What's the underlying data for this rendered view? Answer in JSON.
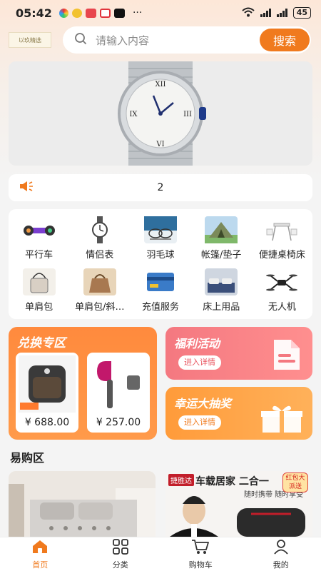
{
  "status_bar": {
    "time": "05:42",
    "more": "···",
    "battery": "45",
    "signal": "6"
  },
  "header": {
    "logo_text": "以玖精选",
    "search_placeholder": "请输入内容",
    "search_button": "搜索"
  },
  "banner": {
    "image": "watch-banner"
  },
  "notice": {
    "icon": "speaker-icon",
    "text": "2"
  },
  "categories": [
    {
      "label": "平行车",
      "icon": "hoverboard-icon"
    },
    {
      "label": "情侣表",
      "icon": "watch-icon"
    },
    {
      "label": "羽毛球",
      "icon": "badminton-icon"
    },
    {
      "label": "帐篷/垫子",
      "icon": "tent-icon"
    },
    {
      "label": "便捷桌椅床",
      "icon": "table-chair-icon"
    },
    {
      "label": "单肩包",
      "icon": "bag-icon"
    },
    {
      "label": "单肩包/斜…",
      "icon": "handbag-icon"
    },
    {
      "label": "充值服务",
      "icon": "card-icon"
    },
    {
      "label": "床上用品",
      "icon": "bed-icon"
    },
    {
      "label": "无人机",
      "icon": "drone-icon"
    }
  ],
  "exchange": {
    "title": "兑换专区",
    "products": [
      {
        "price": "¥ 688.00",
        "image": "air-fryer"
      },
      {
        "price": "¥ 257.00",
        "image": "hair-dryer"
      }
    ]
  },
  "welfare": {
    "title": "福利活动",
    "button": "进入详情",
    "icon": "document-icon"
  },
  "lucky": {
    "title": "幸运大抽奖",
    "button": "进入详情",
    "icon": "gift-icon"
  },
  "section": {
    "title": "易购区"
  },
  "goods": [
    {
      "image": "bedding"
    },
    {
      "brand": "捷胜达",
      "title": "车载居家 二合一",
      "sub": "随时携带 随时享受",
      "tag": "红包大派送",
      "image": "car-massager"
    }
  ],
  "tabbar": [
    {
      "label": "首页",
      "icon": "home-icon",
      "active": true
    },
    {
      "label": "分类",
      "icon": "grid-icon",
      "active": false
    },
    {
      "label": "购物车",
      "icon": "cart-icon",
      "active": false
    },
    {
      "label": "我的",
      "icon": "person-icon",
      "active": false
    }
  ],
  "colors": {
    "accent": "#f07a1e",
    "welfare": "#f47880",
    "lucky": "#ff9b3a"
  }
}
